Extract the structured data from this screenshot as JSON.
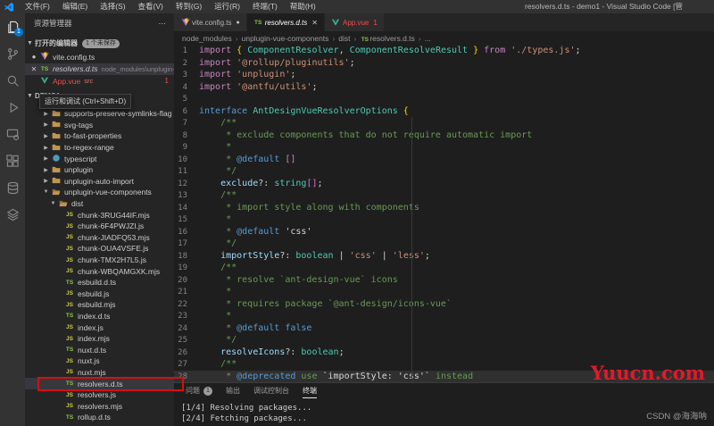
{
  "window": {
    "title": "resolvers.d.ts - demo1 - Visual Studio Code [管",
    "menus": [
      "文件(F)",
      "编辑(E)",
      "选择(S)",
      "查看(V)",
      "转到(G)",
      "运行(R)",
      "终端(T)",
      "帮助(H)"
    ]
  },
  "activity_bar": {
    "icons": [
      {
        "name": "explorer-icon",
        "active": true,
        "badge": "1"
      },
      {
        "name": "source-control-icon"
      },
      {
        "name": "search-icon"
      },
      {
        "name": "run-debug-icon"
      },
      {
        "name": "remote-icon"
      },
      {
        "name": "extensions-icon"
      },
      {
        "name": "database-icon"
      },
      {
        "name": "layers-icon"
      }
    ]
  },
  "sidebar": {
    "title": "资源管理器",
    "actions": "⋯",
    "open_editors": {
      "label": "打开的编辑器",
      "badge": "1 个未保存",
      "items": [
        {
          "icon": "vite",
          "label": "vite.config.ts",
          "modified": true
        },
        {
          "icon": "ts",
          "label": "resolvers.d.ts",
          "desc": "node_modules\\unplugin-vue-...",
          "selected": true,
          "italic": true,
          "close": true
        },
        {
          "icon": "vue",
          "label": "App.vue",
          "desc": "src",
          "error": true,
          "badge": "1"
        }
      ]
    },
    "project": {
      "label": "DEMO1"
    },
    "tooltip": "运行和调试 (Ctrl+Shift+D)",
    "tree": [
      {
        "kind": "folder",
        "icon": "folder",
        "label": "supports-preserve-symlinks-flag",
        "level": 0
      },
      {
        "kind": "folder",
        "icon": "folder",
        "label": "svg-tags",
        "level": 0
      },
      {
        "kind": "folder",
        "icon": "folder",
        "label": "to-fast-properties",
        "level": 0
      },
      {
        "kind": "folder",
        "icon": "folder",
        "label": "to-regex-range",
        "level": 0
      },
      {
        "kind": "folder",
        "icon": "folder-blue",
        "label": "typescript",
        "level": 0
      },
      {
        "kind": "folder",
        "icon": "folder",
        "label": "unplugin",
        "level": 0
      },
      {
        "kind": "folder",
        "icon": "folder",
        "label": "unplugin-auto-import",
        "level": 0
      },
      {
        "kind": "folder",
        "icon": "folder-open",
        "label": "unplugin-vue-components",
        "level": 0,
        "open": true
      },
      {
        "kind": "folder",
        "icon": "folder-open",
        "label": "dist",
        "level": 1,
        "open": true
      },
      {
        "kind": "file",
        "icon": "js",
        "label": "chunk-3RUG44IF.mjs",
        "level": 2
      },
      {
        "kind": "file",
        "icon": "js",
        "label": "chunk-6F4PWJZI.js",
        "level": 2
      },
      {
        "kind": "file",
        "icon": "js",
        "label": "chunk-JIADFQ53.mjs",
        "level": 2
      },
      {
        "kind": "file",
        "icon": "js",
        "label": "chunk-OUA4VSFE.js",
        "level": 2
      },
      {
        "kind": "file",
        "icon": "js",
        "label": "chunk-TMX2H7L5.js",
        "level": 2
      },
      {
        "kind": "file",
        "icon": "js",
        "label": "chunk-WBQAMGXK.mjs",
        "level": 2
      },
      {
        "kind": "file",
        "icon": "ts",
        "label": "esbuild.d.ts",
        "level": 2
      },
      {
        "kind": "file",
        "icon": "js",
        "label": "esbuild.js",
        "level": 2
      },
      {
        "kind": "file",
        "icon": "js",
        "label": "esbuild.mjs",
        "level": 2
      },
      {
        "kind": "file",
        "icon": "ts",
        "label": "index.d.ts",
        "level": 2
      },
      {
        "kind": "file",
        "icon": "js",
        "label": "index.js",
        "level": 2
      },
      {
        "kind": "file",
        "icon": "js",
        "label": "index.mjs",
        "level": 2
      },
      {
        "kind": "file",
        "icon": "ts",
        "label": "nuxt.d.ts",
        "level": 2
      },
      {
        "kind": "file",
        "icon": "js",
        "label": "nuxt.js",
        "level": 2
      },
      {
        "kind": "file",
        "icon": "js",
        "label": "nuxt.mjs",
        "level": 2
      },
      {
        "kind": "file",
        "icon": "ts",
        "label": "resolvers.d.ts",
        "level": 2,
        "selected": true
      },
      {
        "kind": "file",
        "icon": "js",
        "label": "resolvers.js",
        "level": 2
      },
      {
        "kind": "file",
        "icon": "js",
        "label": "resolvers.mjs",
        "level": 2
      },
      {
        "kind": "file",
        "icon": "ts",
        "label": "rollup.d.ts",
        "level": 2
      }
    ]
  },
  "editor": {
    "tabs": [
      {
        "icon": "vite",
        "label": "vite.config.ts",
        "modified": true
      },
      {
        "icon": "ts",
        "label": "resolvers.d.ts",
        "active": true,
        "italic": true,
        "close": true
      },
      {
        "icon": "vue",
        "label": "App.vue",
        "error": true,
        "badge": "1"
      }
    ],
    "breadcrumbs": [
      "node_modules",
      "unplugin-vue-components",
      "dist",
      "resolvers.d.ts",
      "..."
    ],
    "code": {
      "active_line": 28,
      "lines": [
        [
          [
            "ctrl",
            "import "
          ],
          [
            "b1",
            "{ "
          ],
          [
            "type",
            "ComponentResolver"
          ],
          [
            "pun",
            ", "
          ],
          [
            "type",
            "ComponentResolveResult"
          ],
          [
            "b1",
            " }"
          ],
          [
            "ctrl",
            " from "
          ],
          [
            "str",
            "'./types.js'"
          ],
          [
            "pun",
            ";"
          ]
        ],
        [
          [
            "ctrl",
            "import "
          ],
          [
            "str",
            "'@rollup/pluginutils'"
          ],
          [
            "pun",
            ";"
          ]
        ],
        [
          [
            "ctrl",
            "import "
          ],
          [
            "str",
            "'unplugin'"
          ],
          [
            "pun",
            ";"
          ]
        ],
        [
          [
            "ctrl",
            "import "
          ],
          [
            "str",
            "'@antfu/utils'"
          ],
          [
            "pun",
            ";"
          ]
        ],
        [],
        [
          [
            "kw",
            "interface "
          ],
          [
            "type",
            "AntDesignVueResolverOptions "
          ],
          [
            "b1",
            "{"
          ]
        ],
        [
          [
            "cmt",
            "    /**"
          ]
        ],
        [
          [
            "cmt",
            "     * exclude components that do not require automatic import"
          ]
        ],
        [
          [
            "cmt",
            "     *"
          ]
        ],
        [
          [
            "cmt",
            "     * "
          ],
          [
            "doc",
            "@default "
          ],
          [
            "dv",
            "[]"
          ]
        ],
        [
          [
            "cmt",
            "     */"
          ]
        ],
        [
          [
            "pun",
            "    "
          ],
          [
            "prop",
            "exclude"
          ],
          [
            "pun",
            "?: "
          ],
          [
            "type",
            "string"
          ],
          [
            "b2",
            "[]"
          ],
          [
            "pun",
            ";"
          ]
        ],
        [
          [
            "cmt",
            "    /**"
          ]
        ],
        [
          [
            "cmt",
            "     * import style along with components"
          ]
        ],
        [
          [
            "cmt",
            "     *"
          ]
        ],
        [
          [
            "cmt",
            "     * "
          ],
          [
            "doc",
            "@default "
          ],
          [
            "lit",
            "'css'"
          ]
        ],
        [
          [
            "cmt",
            "     */"
          ]
        ],
        [
          [
            "pun",
            "    "
          ],
          [
            "prop",
            "importStyle"
          ],
          [
            "pun",
            "?: "
          ],
          [
            "type",
            "boolean"
          ],
          [
            "pun",
            " | "
          ],
          [
            "str",
            "'css'"
          ],
          [
            "pun",
            " | "
          ],
          [
            "str",
            "'less'"
          ],
          [
            "pun",
            ";"
          ]
        ],
        [
          [
            "cmt",
            "    /**"
          ]
        ],
        [
          [
            "cmt",
            "     * resolve `ant-design-vue` icons"
          ]
        ],
        [
          [
            "cmt",
            "     *"
          ]
        ],
        [
          [
            "cmt",
            "     * requires package `@ant-design/icons-vue`"
          ]
        ],
        [
          [
            "cmt",
            "     *"
          ]
        ],
        [
          [
            "cmt",
            "     * "
          ],
          [
            "doc",
            "@default "
          ],
          [
            "kw",
            "false"
          ]
        ],
        [
          [
            "cmt",
            "     */"
          ]
        ],
        [
          [
            "pun",
            "    "
          ],
          [
            "prop",
            "resolveIcons"
          ],
          [
            "pun",
            "?: "
          ],
          [
            "type",
            "boolean"
          ],
          [
            "pun",
            ";"
          ]
        ],
        [
          [
            "cmt",
            "    /**"
          ]
        ],
        [
          [
            "cmt",
            "     * "
          ],
          [
            "doc",
            "@deprecated"
          ],
          [
            "cmt",
            " use "
          ],
          [
            "lit",
            "`importStyle: 'css'`"
          ],
          [
            "cmt",
            " instead"
          ]
        ]
      ]
    }
  },
  "panel": {
    "tabs": [
      {
        "label": "问题",
        "badge": "1"
      },
      {
        "label": "输出"
      },
      {
        "label": "调试控制台"
      },
      {
        "label": "终端",
        "active": true
      }
    ],
    "terminal": [
      "[1/4] Resolving packages...",
      "[2/4] Fetching packages..."
    ]
  },
  "overlays": {
    "watermark": "Yuucn.com",
    "credit": "CSDN @海海呐"
  }
}
